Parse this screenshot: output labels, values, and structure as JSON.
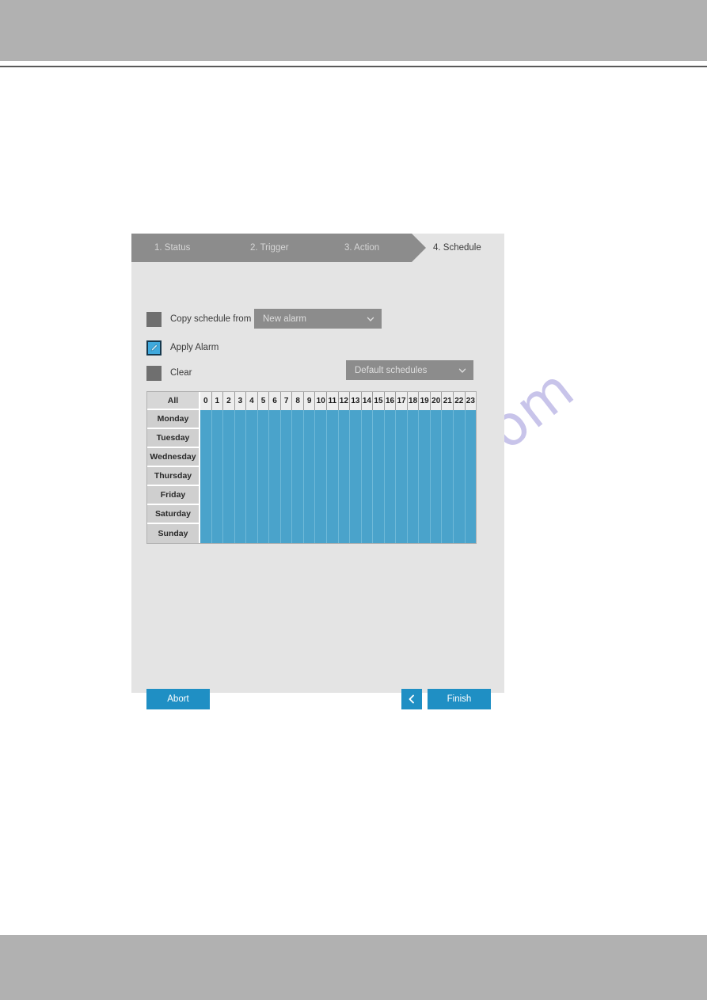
{
  "page": {
    "watermark_text": "manualshive.com"
  },
  "dialog": {
    "steps": [
      {
        "label": "1. Status",
        "current": false
      },
      {
        "label": "2. Trigger",
        "current": false
      },
      {
        "label": "3. Action",
        "current": false
      },
      {
        "label": "4. Schedule",
        "current": true
      }
    ],
    "options": [
      {
        "label": "Copy schedule from",
        "icon": "checkbox-empty-icon",
        "selected": false
      },
      {
        "label": "Apply Alarm",
        "icon": "pencil-icon",
        "selected": true
      },
      {
        "label": "Clear",
        "icon": "checkbox-empty-icon",
        "selected": false
      }
    ],
    "copy_schedule_dropdown": {
      "value": "New alarm",
      "caret_icon": "chevron-down-icon"
    },
    "default_schedules_dropdown": {
      "value": "Default schedules",
      "caret_icon": "chevron-down-icon"
    },
    "schedule_grid": {
      "all_label": "All",
      "hours": [
        "0",
        "1",
        "2",
        "3",
        "4",
        "5",
        "6",
        "7",
        "8",
        "9",
        "10",
        "11",
        "12",
        "13",
        "14",
        "15",
        "16",
        "17",
        "18",
        "19",
        "20",
        "21",
        "22",
        "23"
      ],
      "days": [
        "Monday",
        "Tuesday",
        "Wednesday",
        "Thursday",
        "Friday",
        "Saturday",
        "Sunday"
      ],
      "selected_color": "#4aa3cb"
    },
    "footer": {
      "abort_label": "Abort",
      "back_icon": "chevron-left-icon",
      "finish_label": "Finish"
    }
  },
  "colors": {
    "accent_blue": "#1f8fc4",
    "grid_blue": "#4aa3cb",
    "panel_bg": "#e4e4e4",
    "step_bar": "#8c8c8c",
    "band_grey": "#b1b1b1"
  }
}
